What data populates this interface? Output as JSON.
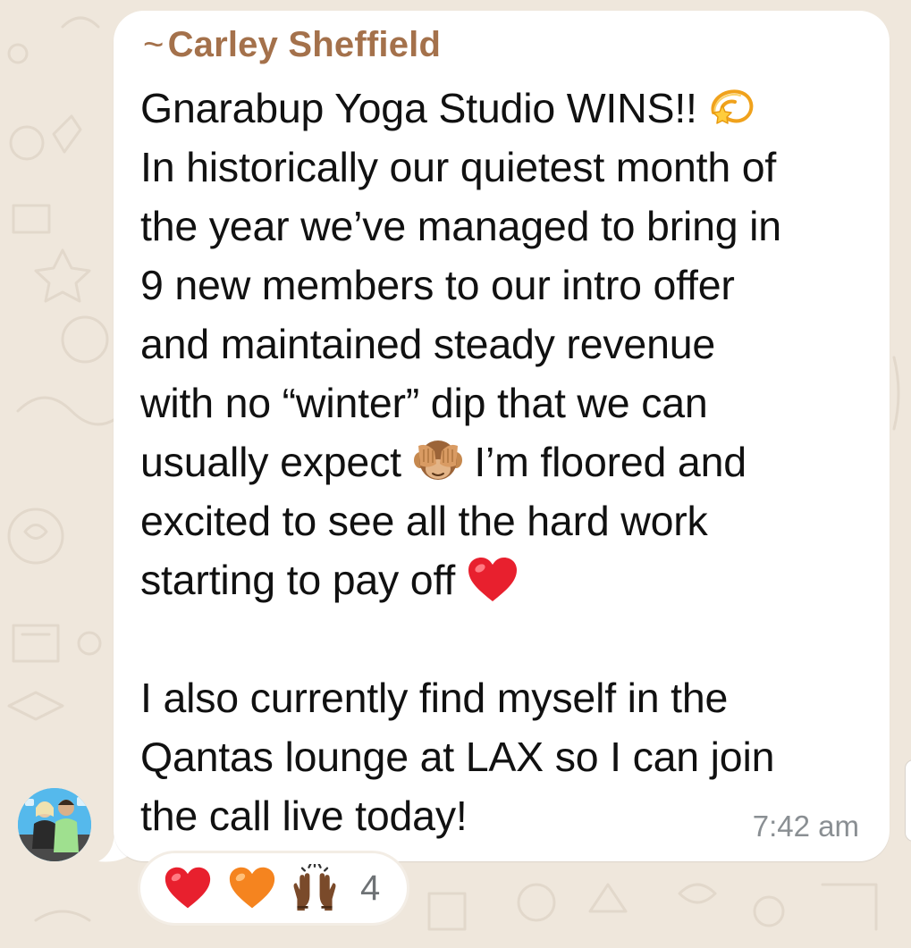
{
  "message": {
    "sender": "Carley Sheffield",
    "sender_prefix": "~",
    "lines": [
      "Gnarabup Yoga Studio WINS!! ",
      "In historically our quietest month of",
      "the year we’ve managed to bring in",
      "9 new members to our intro offer",
      "and maintained steady revenue",
      "with no “winter” dip that we can",
      "usually expect ",
      " I’m floored and",
      "excited to see all the hard work",
      "starting to pay off ",
      "",
      "I also currently find myself in the",
      "Qantas lounge at LAX so I can join",
      "the call live today!"
    ],
    "time": "7:42 am"
  },
  "reactions": {
    "emojis": [
      "red-heart",
      "orange-heart",
      "raising-hands"
    ],
    "count": "4"
  },
  "colors": {
    "sender": "#a4714b",
    "bubble": "#ffffff",
    "background": "#efe7dc",
    "timestamp": "#8a8f93"
  },
  "icons": {
    "line1": "dizzy-emoji",
    "line7": "see-no-evil-monkey-emoji",
    "line10": "red-heart-emoji"
  }
}
